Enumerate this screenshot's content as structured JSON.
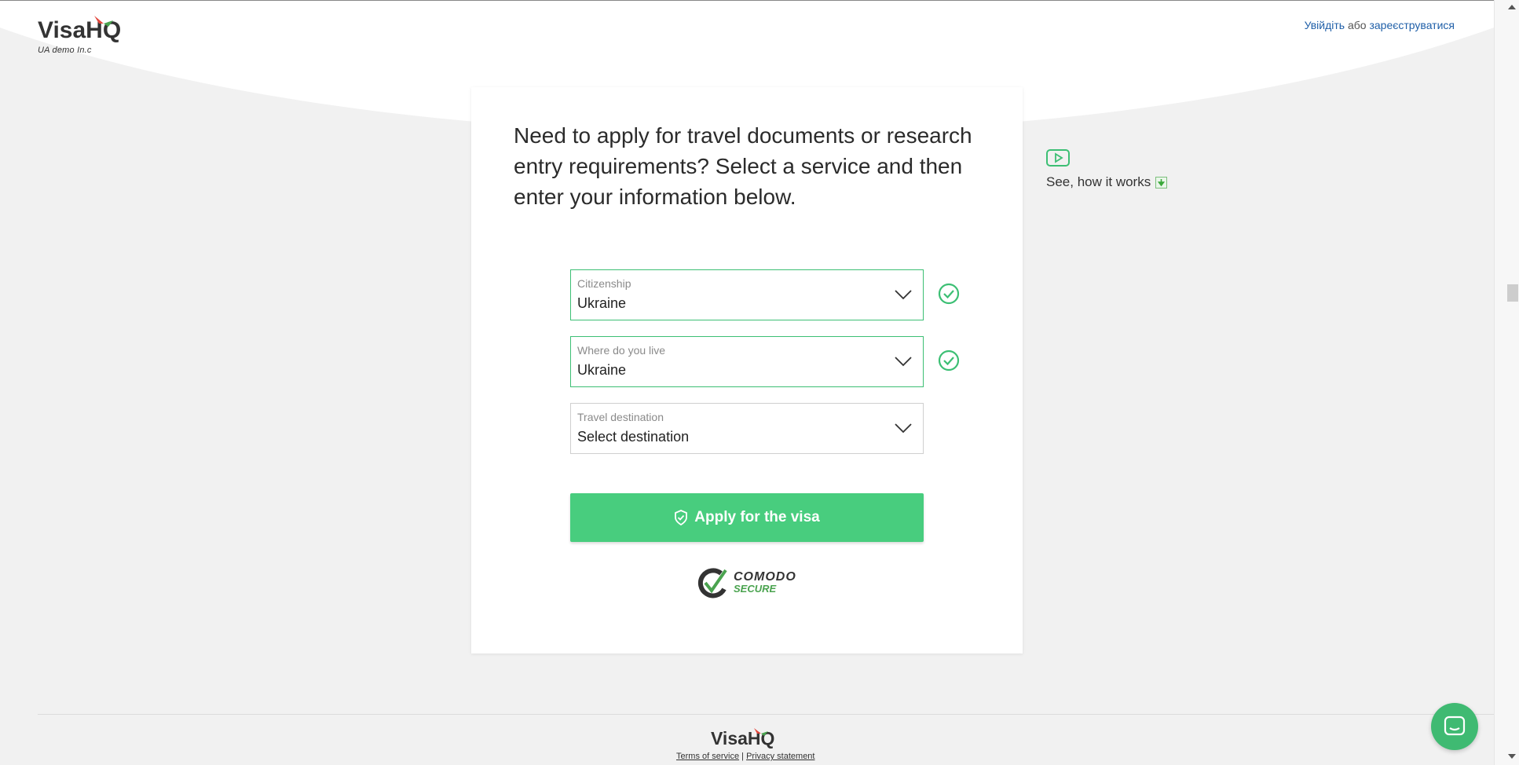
{
  "header": {
    "brand": "VisaHQ",
    "brand_sub": "UA demo In.c",
    "login_label": "Увійдіть",
    "or_label": "або",
    "register_label": "зареєструватися"
  },
  "main": {
    "headline": "Need to apply for travel documents or research entry requirements? Select a service and then enter your information below.",
    "fields": [
      {
        "label": "Citizenship",
        "value": "Ukraine",
        "valid": true
      },
      {
        "label": "Where do you live",
        "value": "Ukraine",
        "valid": true
      },
      {
        "label": "Travel destination",
        "value": "Select destination",
        "valid": false
      }
    ],
    "apply_label": "Apply for the visa",
    "badge": {
      "line1": "COMODO",
      "line2": "SECURE"
    }
  },
  "how_it_works": {
    "label": "See, how it works"
  },
  "footer": {
    "brand": "VisaHQ",
    "terms_label": "Terms of service",
    "separator": "|",
    "privacy_label": "Privacy statement"
  },
  "colors": {
    "accent_green": "#48cd7e",
    "link_blue": "#1f5fa8",
    "valid_border": "#3cbf74"
  },
  "icons": {
    "check": "check-circle-icon",
    "chevron": "chevron-down-icon",
    "shield": "shield-check-icon",
    "play": "play-icon",
    "download": "download-icon",
    "chat": "chat-icon"
  }
}
